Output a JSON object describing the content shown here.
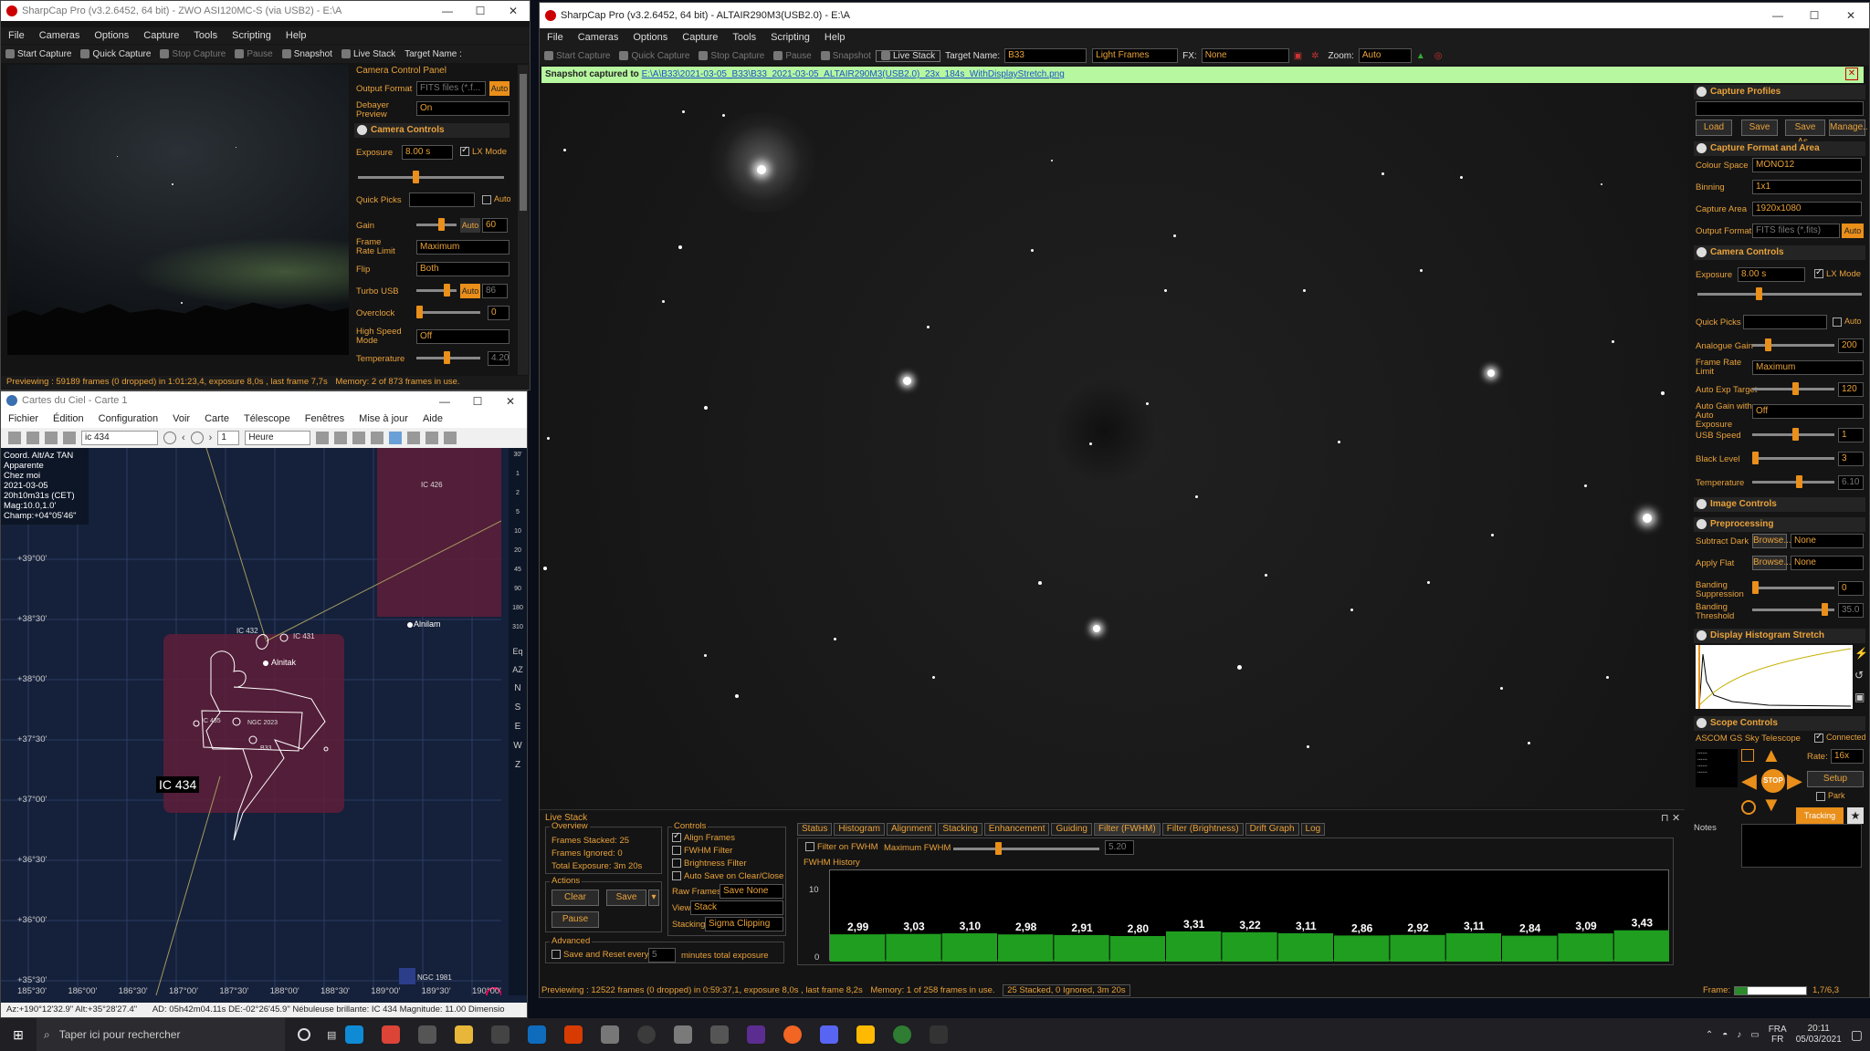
{
  "camwin": {
    "title": "SharpCap Pro (v3.2.6452, 64 bit) - ZWO ASI120MC-S (via USB2) - E:\\A",
    "menus": [
      "File",
      "Cameras",
      "Options",
      "Capture",
      "Tools",
      "Scripting",
      "Help"
    ],
    "toolbar": {
      "start": "Start Capture",
      "quick": "Quick Capture",
      "stop": "Stop Capture",
      "pause": "Pause",
      "snapshot": "Snapshot",
      "live": "Live Stack",
      "target": "Target Name :"
    },
    "panel_title": "Camera Control Panel",
    "output_format_label": "Output Format",
    "output_format_value": "FITS files (*.f...",
    "auto": "Auto",
    "debayer_label": "Debayer Preview",
    "debayer_value": "On",
    "camera_controls": "Camera Controls",
    "exposure_label": "Exposure",
    "exposure_value": "8.00 s",
    "lx_mode": "LX Mode",
    "quick_picks": "Quick Picks",
    "gain_label": "Gain",
    "gain_value": "60",
    "frame_rate_label": "Frame Rate Limit",
    "frame_rate_value": "Maximum",
    "flip_label": "Flip",
    "flip_value": "Both",
    "turbo_label": "Turbo USB",
    "turbo_value": "86",
    "overclock_label": "Overclock",
    "overclock_value": "0",
    "hsm_label": "High Speed Mode",
    "hsm_value": "Off",
    "temp_label": "Temperature",
    "temp_value": "4.20",
    "status": "Previewing : 59189 frames (0 dropped) in 1:01:23,4, exposure 8,0s , last frame 7,7s",
    "memory": "Memory: 2 of 873 frames in use."
  },
  "cdc": {
    "title": "Cartes du Ciel - Carte 1",
    "menus": [
      "Fichier",
      "Édition",
      "Configuration",
      "Voir",
      "Carte",
      "Télescope",
      "Fenêtres",
      "Mise à jour",
      "Aide"
    ],
    "search": "ic 434",
    "step": "1",
    "unit": "Heure",
    "info": [
      "Coord. Alt/Az TAN",
      "Apparente",
      "Chez moi",
      "2021-03-05",
      "20h10m31s (CET)",
      "Mag:10.0,1.0'",
      "Champ:+04°05'46\""
    ],
    "dec_labels": [
      "+39°00'",
      "+38°30'",
      "+38°00'",
      "+37°30'",
      "+37°00'",
      "+36°30'",
      "+36°00'",
      "+35°30'"
    ],
    "ra_labels": [
      "185°30'",
      "186°00'",
      "186°30'",
      "187°00'",
      "187°30'",
      "188°00'",
      "188°30'",
      "189°00'",
      "189°30'",
      "190°00'"
    ],
    "objects": {
      "ic426": "IC 426",
      "ic432": "IC 432",
      "ic431": "IC 431",
      "alnilam": "Alnilam",
      "alnitak": "Alnitak",
      "ic435": "IC 435",
      "ngc2023": "NGC 2023",
      "b33": "B33",
      "ic434": "IC 434",
      "ngc1981": "NGC 1981"
    },
    "fov_scale": [
      "30'",
      "1",
      "2",
      "5",
      "10",
      "20",
      "45",
      "90",
      "180",
      "310",
      "Eq",
      "AZ",
      "N",
      "S",
      "E",
      "W",
      "Z"
    ],
    "status": "Az:+190°12'32.9\" Alt:+35°28'27.4\"",
    "status2": "AD: 05h42m04.11s DE:-02°26'45.9\" Nébuleuse brillante: IC 434 Magnitude: 11.00 Dimensio"
  },
  "main": {
    "title": "SharpCap Pro (v3.2.6452, 64 bit) - ALTAIR290M3(USB2.0) - E:\\A",
    "menus": [
      "File",
      "Cameras",
      "Options",
      "Capture",
      "Tools",
      "Scripting",
      "Help"
    ],
    "toolbar": {
      "start": "Start Capture",
      "quick": "Quick Capture",
      "stop": "Stop Capture",
      "pause": "Pause",
      "snapshot": "Snapshot",
      "live": "Live Stack",
      "target": "Target Name:",
      "target_value": "B33",
      "frames": "Light Frames",
      "fx": "FX:",
      "fx_value": "None",
      "zoom": "Zoom:",
      "zoom_value": "Auto"
    },
    "snapshot_prefix": "Snapshot captured to ",
    "snapshot_path": "E:\\A\\B33\\2021-03-05_B33\\B33_2021-03-05_ALTAIR290M3(USB2.0)_23x_184s_WithDisplayStretch.png",
    "status": "Previewing : 12522 frames (0 dropped) in 0:59:37,1, exposure 8,0s , last frame 8,2s",
    "memory": "Memory: 1 of 258 frames in use.",
    "stacked": "25 Stacked, 0 Ignored, 3m 20s",
    "frame_label": "Frame:",
    "frame_value": "1,7/6,3"
  },
  "right": {
    "capture_profiles": "Capture Profiles",
    "btn_load": "Load",
    "btn_save": "Save",
    "btn_saveas": "Save As..",
    "btn_manage": "Manage..",
    "cfa": "Capture Format and Area",
    "colour_space_label": "Colour Space",
    "colour_space": "MONO12",
    "binning_label": "Binning",
    "binning": "1x1",
    "area_label": "Capture Area",
    "area": "1920x1080",
    "format_label": "Output Format",
    "format": "FITS files (*.fits)",
    "auto": "Auto",
    "camera_controls": "Camera Controls",
    "exposure_label": "Exposure",
    "exposure": "8.00 s",
    "lx_mode": "LX Mode",
    "quick_picks": "Quick Picks",
    "again_label": "Analogue Gain",
    "again": "200",
    "frl_label": "Frame Rate Limit",
    "frl": "Maximum",
    "aet_label": "Auto Exp Target",
    "aet": "120",
    "agae_label": "Auto Gain with Auto Exposure",
    "agae": "Off",
    "usb_label": "USB Speed",
    "usb": "1",
    "black_label": "Black Level",
    "black": "3",
    "temp_label": "Temperature",
    "temp": "6.10",
    "image_controls": "Image Controls",
    "preprocessing": "Preprocessing",
    "dark_label": "Subtract Dark",
    "flat_label": "Apply Flat",
    "browse": "Browse...",
    "none": "None",
    "bs_label": "Banding Suppression",
    "bs": "0",
    "bt_label": "Banding Threshold",
    "bt": "35.0",
    "histo": "Display Histogram Stretch",
    "scope": "Scope Controls",
    "scope_name": "ASCOM GS Sky Telescope",
    "connected": "Connected",
    "rate_label": "Rate:",
    "rate": "16x",
    "setup": "Setup",
    "stop": "STOP",
    "park": "Park",
    "tracking": "Tracking",
    "notes": "Notes"
  },
  "livestack": {
    "title": "Live Stack",
    "overview": "Overview",
    "stacked": "Frames Stacked: 25",
    "ignored": "Frames Ignored:  0",
    "total": "Total Exposure:  3m 20s",
    "actions": "Actions",
    "clear": "Clear",
    "save": "Save",
    "pause": "Pause",
    "controls": "Controls",
    "align": "Align Frames",
    "fwhm_f": "FWHM Filter",
    "bright_f": "Brightness Filter",
    "autosave": "Auto Save on Clear/Close",
    "raw_label": "Raw Frames",
    "raw": "Save None",
    "view_label": "View",
    "view": "Stack",
    "stacking_label": "Stacking",
    "stacking": "Sigma Clipping",
    "advanced": "Advanced",
    "save_reset": "Save and Reset every",
    "save_reset_val": "5",
    "minutes": "minutes total exposure",
    "tabs": [
      "Status",
      "Histogram",
      "Alignment",
      "Stacking",
      "Enhancement",
      "Guiding",
      "Filter (FWHM)",
      "Filter (Brightness)",
      "Drift Graph",
      "Log"
    ],
    "filter_on": "Filter on FWHM",
    "max_fwhm": "Maximum FWHM",
    "max_fwhm_val": "5.20",
    "history": "FWHM History",
    "y_top": "10",
    "y_bot": "0",
    "fwhm_values": [
      "2,99",
      "3,03",
      "3,10",
      "2,98",
      "2,91",
      "2,80",
      "3,31",
      "3,22",
      "3,11",
      "2,86",
      "2,92",
      "3,11",
      "2,84",
      "3,09",
      "3,43"
    ]
  },
  "taskbar": {
    "search": "Taper ici pour rechercher",
    "lang1": "FRA",
    "lang2": "FR",
    "time": "20:11",
    "date": "05/03/2021"
  }
}
